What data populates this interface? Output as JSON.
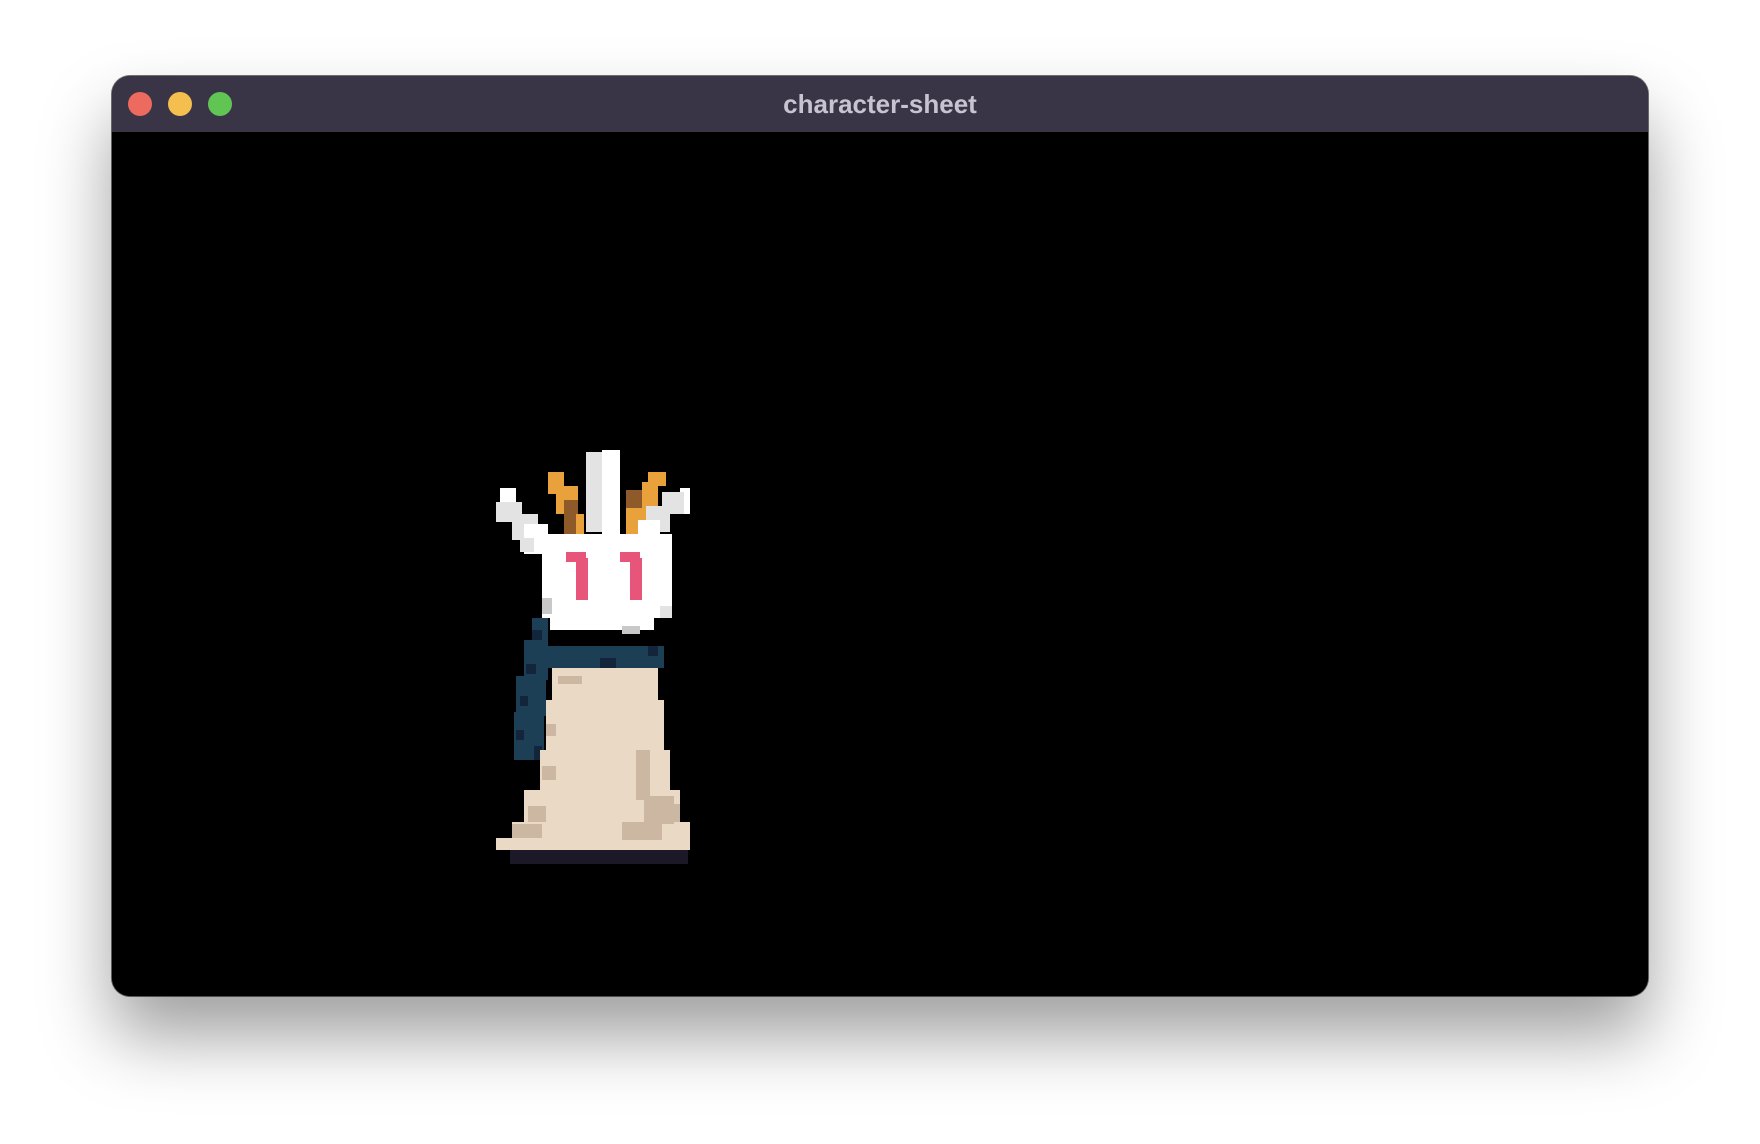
{
  "window": {
    "title": "character-sheet"
  },
  "traffic_lights": {
    "close_color": "#ed6a5e",
    "minimize_color": "#f5bf4f",
    "zoom_color": "#61c554"
  },
  "scene": {
    "background_color": "#000000",
    "character": {
      "description_icon": "hooded-pixel-character-with-raised-arms",
      "palette": {
        "white": "#ffffff",
        "light_gray": "#e3e3e3",
        "mid_gray": "#c8c8c8",
        "gold": "#e9a23b",
        "brown": "#8f5a2a",
        "pink": "#e8557b",
        "cape_blue": "#1d3f56",
        "cape_dark": "#13253a",
        "robe": "#ead9c4",
        "robe_shade": "#cbb7a2",
        "shadow": "#1c1828"
      }
    }
  }
}
